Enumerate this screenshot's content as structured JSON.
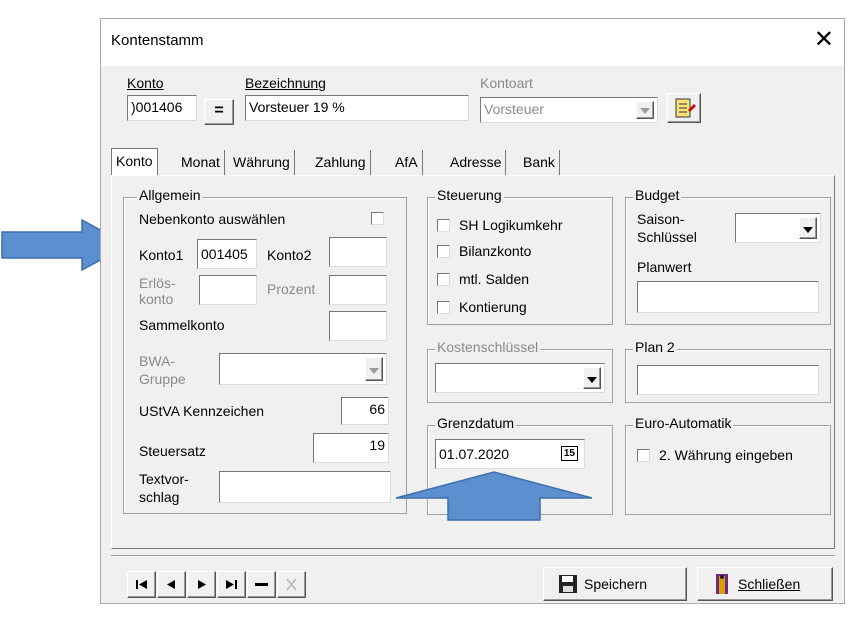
{
  "window": {
    "title": "Kontenstamm"
  },
  "header": {
    "konto_label": "Konto",
    "konto_value": ")001406",
    "eq_button": "=",
    "bezeichnung_label": "Bezeichnung",
    "bezeichnung_value": "Vorsteuer 19 %",
    "kontoart_label": "Kontoart",
    "kontoart_value": "Vorsteuer"
  },
  "tabs": [
    "Konto",
    "Monat",
    "Währung",
    "Zahlung",
    "AfA",
    "Adresse",
    "Bank"
  ],
  "allgemein": {
    "title": "Allgemein",
    "nebenkonto_label": "Nebenkonto auswählen",
    "konto1_label": "Konto1",
    "konto1_value": "001405",
    "konto2_label": "Konto2",
    "erloes_label_1": "Erlös-",
    "erloes_label_2": "konto",
    "prozent_label": "Prozent",
    "sammelkonto_label": "Sammelkonto",
    "bwa_label_1": "BWA-",
    "bwa_label_2": "Gruppe",
    "ustva_label": "UStVA Kennzeichen",
    "ustva_value": "66",
    "steuersatz_label": "Steuersatz",
    "steuersatz_value": "19",
    "textvor_label_1": "Textvor-",
    "textvor_label_2": "schlag"
  },
  "steuerung": {
    "title": "Steuerung",
    "items": [
      "SH Logikumkehr",
      "Bilanzkonto",
      "mtl. Salden",
      "Kontierung"
    ]
  },
  "budget": {
    "title": "Budget",
    "saison_label_1": "Saison-",
    "saison_label_2": "Schlüssel",
    "planwert_label": "Planwert"
  },
  "kostenschluessel": {
    "title": "Kostenschlüssel"
  },
  "plan2": {
    "title": "Plan 2"
  },
  "grenzdatum": {
    "title": "Grenzdatum",
    "value": "01.07.2020",
    "cal_icon_text": "15"
  },
  "euro": {
    "title": "Euro-Automatik",
    "checkbox_label": "2. Währung eingeben"
  },
  "footer": {
    "save_label": "Speichern",
    "close_label": "Schließen"
  },
  "colors": {
    "arrow_fill": "#5b8fd0",
    "arrow_stroke": "#3d6fae",
    "window_bg": "#f0f0f0"
  }
}
